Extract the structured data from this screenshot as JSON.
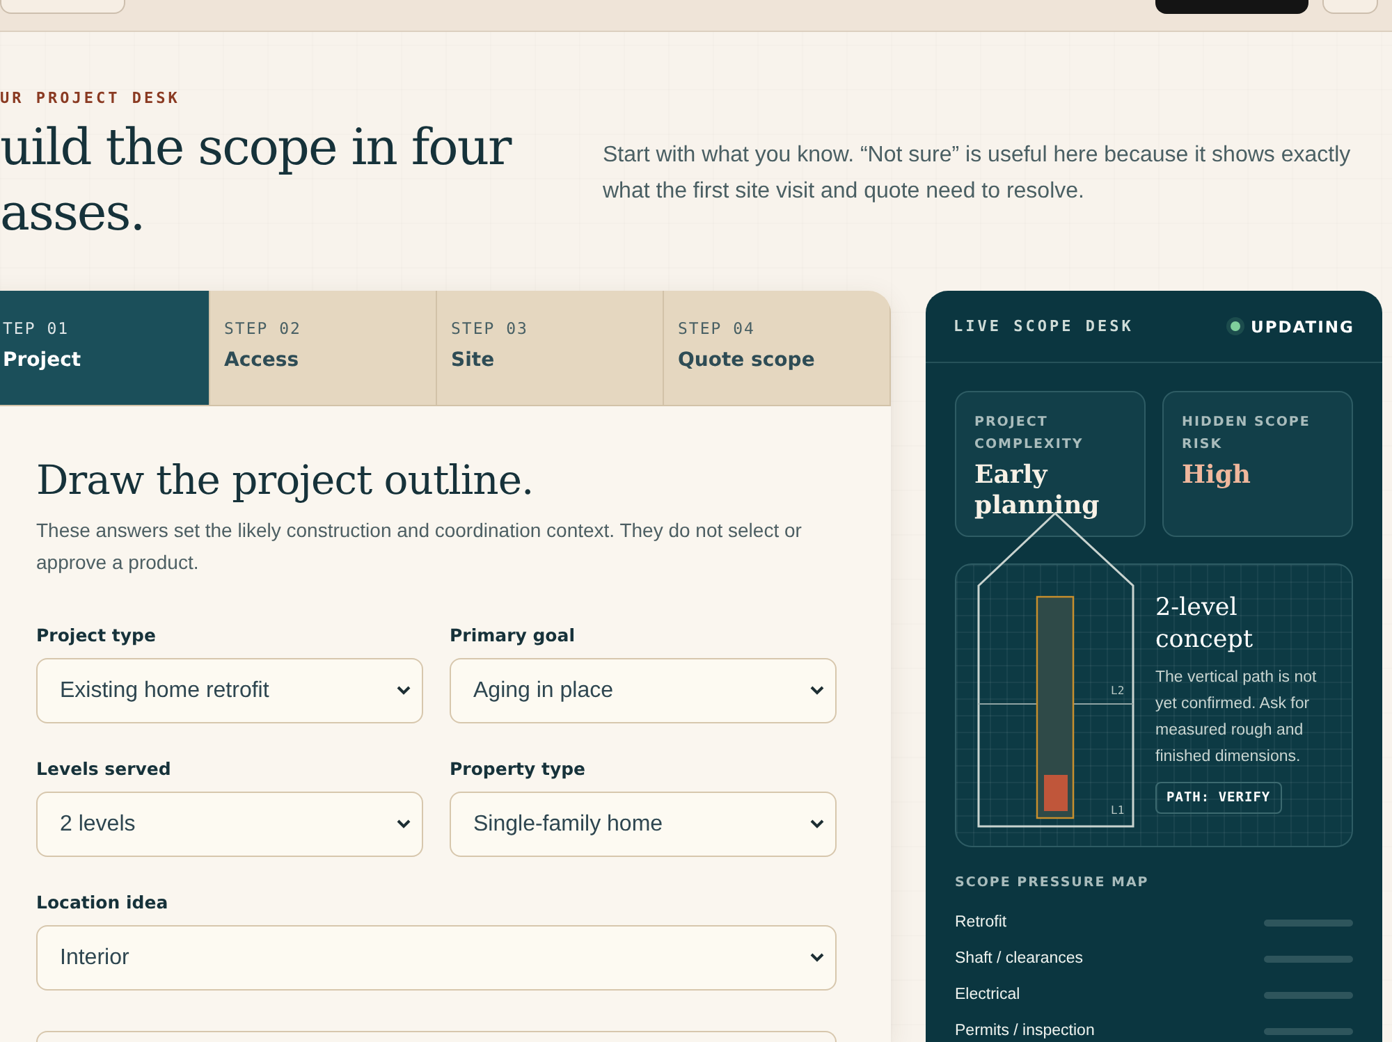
{
  "top_bar": {
    "buttons": [
      {
        "kind": "outline"
      },
      {
        "kind": "dark"
      },
      {
        "kind": "outline-small"
      }
    ]
  },
  "hero": {
    "eyebrow": "UR PROJECT DESK",
    "title_lines": [
      "uild the scope in four",
      "asses."
    ],
    "intro": "Start with what you know. “Not sure” is useful here because it shows exactly what the first site visit and quote need to resolve."
  },
  "steps": [
    {
      "step": "TEP 01",
      "label": "Project",
      "selected": true
    },
    {
      "step": "STEP 02",
      "label": "Access",
      "selected": false
    },
    {
      "step": "STEP 03",
      "label": "Site",
      "selected": false
    },
    {
      "step": "STEP 04",
      "label": "Quote scope",
      "selected": false
    }
  ],
  "form": {
    "title": "Draw the project outline.",
    "description": "These answers set the likely construction and coordination context. They do not select or approve a product.",
    "fields": [
      {
        "label": "Project type",
        "value": "Existing home retrofit",
        "wide": false
      },
      {
        "label": "Primary goal",
        "value": "Aging in place",
        "wide": false
      },
      {
        "label": "Levels served",
        "value": "2 levels",
        "wide": false
      },
      {
        "label": "Property type",
        "value": "Single-family home",
        "wide": false
      },
      {
        "label": "Location idea",
        "value": "Interior",
        "wide": true
      }
    ]
  },
  "scope_desk": {
    "title": "LIVE SCOPE DESK",
    "status": "UPDATING",
    "metrics": [
      {
        "label": "PROJECT COMPLEXITY",
        "value": "Early planning",
        "color": "#f7f1e6"
      },
      {
        "label": "HIDDEN SCOPE RISK",
        "value": "High",
        "color": "#f0b79c"
      }
    ],
    "concept": {
      "title": "2-level concept",
      "text": "The vertical path is not yet confirmed. Ask for measured rough and finished dimensions.",
      "badge": "PATH: VERIFY",
      "level_labels": [
        "L2",
        "L1"
      ]
    },
    "pressure_title": "SCOPE PRESSURE MAP",
    "pressure": [
      {
        "name": "Retrofit",
        "level": 0
      },
      {
        "name": "Shaft / clearances",
        "level": 0
      },
      {
        "name": "Electrical",
        "level": 0
      },
      {
        "name": "Permits / inspection",
        "level": 0
      }
    ]
  }
}
